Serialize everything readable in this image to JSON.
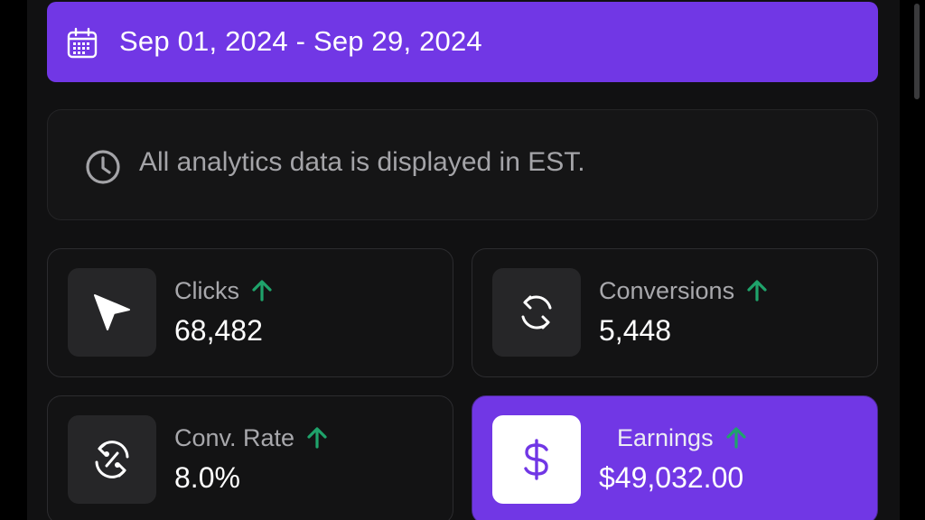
{
  "date_range": {
    "label": "Sep 01, 2024 - Sep 29, 2024",
    "icon": "calendar-icon"
  },
  "notice": {
    "text": "All analytics data is displayed in EST.",
    "icon": "clock-icon"
  },
  "metrics": [
    {
      "label": "Clicks",
      "value": "68,482",
      "trend": "up",
      "icon": "cursor-arrow-icon"
    },
    {
      "label": "Conversions",
      "value": "5,448",
      "trend": "up",
      "icon": "refresh-cycle-icon"
    },
    {
      "label": "Conv. Rate",
      "value": "8.0%",
      "trend": "up",
      "icon": "percent-cycle-icon"
    },
    {
      "label": "Earnings",
      "value": "$49,032.00",
      "trend": "up",
      "icon": "dollar-icon"
    }
  ],
  "colors": {
    "accent": "#7137e5",
    "trend_up": "#1fa36b",
    "background": "#111112",
    "card": "#131314"
  }
}
